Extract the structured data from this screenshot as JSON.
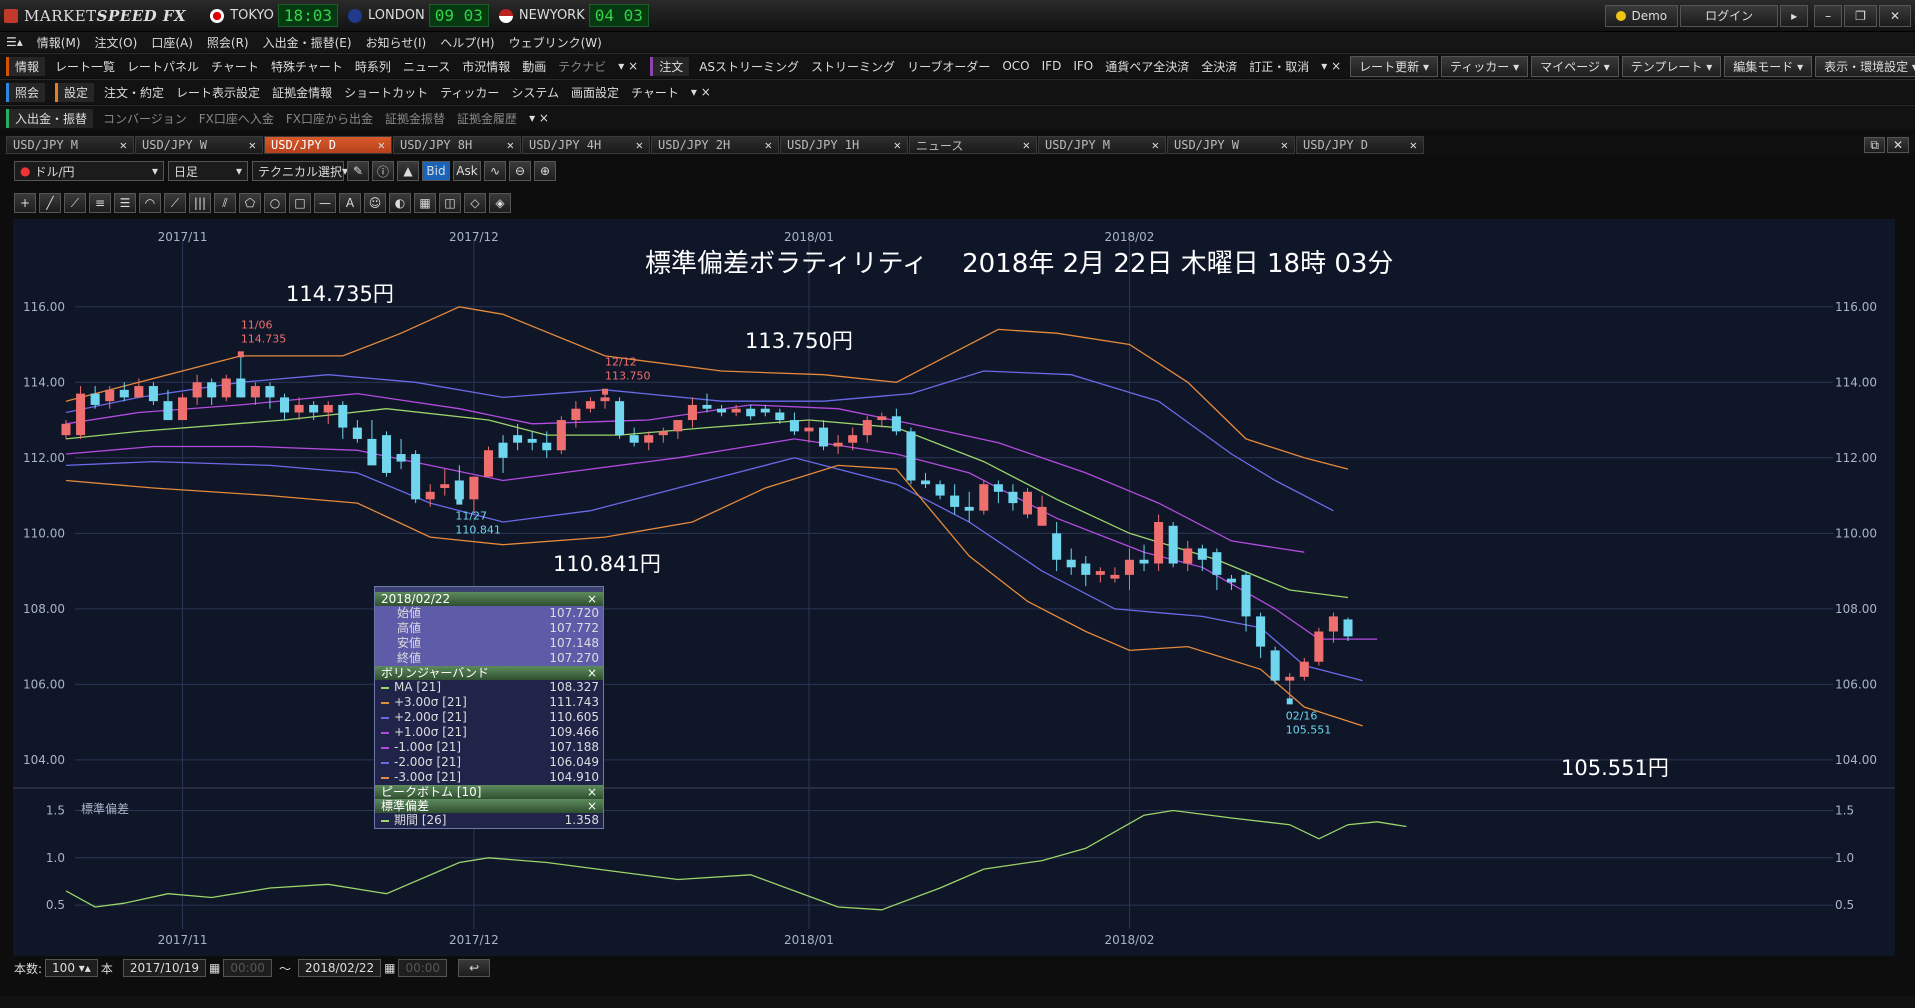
{
  "app": {
    "brand_a": "MARKET",
    "brand_b": "SPEED FX"
  },
  "clocks": [
    {
      "name": "TOKYO",
      "time": "18:03"
    },
    {
      "name": "LONDON",
      "time": "09 03"
    },
    {
      "name": "NEWYORK",
      "time": "04 03"
    }
  ],
  "window_buttons": {
    "demo": "Demo",
    "login": "ログイン"
  },
  "menu": [
    "情報(M)",
    "注文(O)",
    "口座(A)",
    "照会(R)",
    "入出金・振替(E)",
    "お知らせ(I)",
    "ヘルプ(H)",
    "ウェブリンク(W)"
  ],
  "toolbar1": {
    "info_group": "情報",
    "info_items": [
      "レート一覧",
      "レートパネル",
      "チャート",
      "特殊チャート",
      "時系列",
      "ニュース",
      "市況情報",
      "動画"
    ],
    "info_dim": "テクナビ",
    "order_group": "注文",
    "order_items": [
      "ASストリーミング",
      "ストリーミング",
      "リーブオーダー",
      "OCO",
      "IFD",
      "IFO",
      "通貨ペア全決済",
      "全決済",
      "訂正・取消"
    ],
    "right": [
      "レート更新",
      "ティッカー",
      "マイページ",
      "テンプレート",
      "編集モード",
      "表示・環境設定"
    ]
  },
  "toolbar2": {
    "query_group": "照会",
    "settings_group": "設定",
    "settings_items": [
      "注文・約定",
      "レート表示設定",
      "証拠金情報",
      "ショートカット",
      "ティッカー",
      "システム",
      "画面設定",
      "チャート"
    ]
  },
  "toolbar3": {
    "group": "入出金・振替",
    "items": [
      "コンバージョン",
      "FX口座へ入金",
      "FX口座から出金",
      "証拠金振替",
      "証拠金履歴"
    ]
  },
  "tabs": [
    "USD/JPY M",
    "USD/JPY W",
    "USD/JPY D",
    "USD/JPY 8H",
    "USD/JPY 4H",
    "USD/JPY 2H",
    "USD/JPY 1H",
    "ニュース",
    "USD/JPY M",
    "USD/JPY W",
    "USD/JPY D"
  ],
  "active_tab_index": 2,
  "symbol_bar": {
    "pair": "ドル/円",
    "period": "日足",
    "technical": "テクニカル選択",
    "bid": "Bid",
    "ask": "Ask"
  },
  "chart_title": "標準偏差ボラティリティ　 2018年 2月 22日 木曜日 18時 03分",
  "annotations": {
    "high1": "114.735円",
    "high2": "113.750円",
    "low1": "110.841円",
    "low2": "105.551円"
  },
  "marks": {
    "m1_date": "11/06",
    "m1_val": "114.735",
    "m2_date": "12/12",
    "m2_val": "113.750",
    "m3_date": "11/27",
    "m3_val": "110.841",
    "m4_date": "02/16",
    "m4_val": "105.551"
  },
  "info_panel": {
    "date": "2018/02/22",
    "ohlc": [
      {
        "label": "始値",
        "value": "107.720"
      },
      {
        "label": "高値",
        "value": "107.772"
      },
      {
        "label": "安値",
        "value": "107.148"
      },
      {
        "label": "終値",
        "value": "107.270"
      }
    ],
    "bb_title": "ボリンジャーバンド",
    "bb": [
      {
        "label": "MA [21]",
        "value": "108.327",
        "color": "#9bd46a"
      },
      {
        "label": "+3.00σ [21]",
        "value": "111.743",
        "color": "#e58a3c"
      },
      {
        "label": "+2.00σ [21]",
        "value": "110.605",
        "color": "#6a6ae8"
      },
      {
        "label": "+1.00σ [21]",
        "value": "109.466",
        "color": "#b44be0"
      },
      {
        "label": "-1.00σ [21]",
        "value": "107.188",
        "color": "#b44be0"
      },
      {
        "label": "-2.00σ [21]",
        "value": "106.049",
        "color": "#6a6ae8"
      },
      {
        "label": "-3.00σ [21]",
        "value": "104.910",
        "color": "#e58a3c"
      }
    ],
    "pb_title": "ピークボトム [10]",
    "sd_title": "標準偏差",
    "sd_row": {
      "label": "期間 [26]",
      "value": "1.358"
    }
  },
  "bottom_bar": {
    "count_label": "本数:",
    "count": "100",
    "unit": "本",
    "from": "2017/10/19",
    "to": "2018/02/22",
    "time_placeholder": "00:00",
    "tilde": "〜"
  },
  "chart_data": {
    "type": "candlestick",
    "title": "標準偏差ボラティリティ　 2018年 2月 22日 木曜日 18時 03分",
    "x_ticks": [
      "2017/11",
      "2017/12",
      "2018/01",
      "2018/02"
    ],
    "x_tick_bars": [
      8,
      28,
      51,
      73
    ],
    "ylim": [
      103.6,
      117.0
    ],
    "y_ticks": [
      "104.00",
      "106.00",
      "108.00",
      "110.00",
      "112.00",
      "114.00",
      "116.00"
    ],
    "candles": [
      [
        112.6,
        113.0,
        112.5,
        112.9
      ],
      [
        112.6,
        113.9,
        112.5,
        113.7
      ],
      [
        113.7,
        113.9,
        113.3,
        113.4
      ],
      [
        113.5,
        113.9,
        113.3,
        113.8
      ],
      [
        113.8,
        114.0,
        113.5,
        113.6
      ],
      [
        113.6,
        114.1,
        113.6,
        113.9
      ],
      [
        113.9,
        114.0,
        113.4,
        113.5
      ],
      [
        113.5,
        113.8,
        113.0,
        113.0
      ],
      [
        113.0,
        113.7,
        113.0,
        113.6
      ],
      [
        113.6,
        114.2,
        113.4,
        114.0
      ],
      [
        114.0,
        114.1,
        113.4,
        113.6
      ],
      [
        113.6,
        114.2,
        113.5,
        114.1
      ],
      [
        114.1,
        114.74,
        113.6,
        113.6
      ],
      [
        113.6,
        114.0,
        113.4,
        113.9
      ],
      [
        113.9,
        114.0,
        113.3,
        113.6
      ],
      [
        113.6,
        113.7,
        113.0,
        113.2
      ],
      [
        113.2,
        113.6,
        113.0,
        113.4
      ],
      [
        113.4,
        113.5,
        113.0,
        113.2
      ],
      [
        113.2,
        113.5,
        112.9,
        113.4
      ],
      [
        113.4,
        113.5,
        112.5,
        112.8
      ],
      [
        112.8,
        113.0,
        112.4,
        112.5
      ],
      [
        112.5,
        113.0,
        111.8,
        111.8
      ],
      [
        112.6,
        112.7,
        111.5,
        111.6
      ],
      [
        112.1,
        112.5,
        111.7,
        111.9
      ],
      [
        112.1,
        112.2,
        110.8,
        110.9
      ],
      [
        110.9,
        111.3,
        110.7,
        111.1
      ],
      [
        111.2,
        111.7,
        111.0,
        111.3
      ],
      [
        111.4,
        111.8,
        110.84,
        110.9
      ],
      [
        110.9,
        111.5,
        110.5,
        111.5
      ],
      [
        111.5,
        112.3,
        111.5,
        112.2
      ],
      [
        112.4,
        112.6,
        111.6,
        112.0
      ],
      [
        112.6,
        112.9,
        112.2,
        112.4
      ],
      [
        112.5,
        112.7,
        112.2,
        112.4
      ],
      [
        112.4,
        112.7,
        112.0,
        112.2
      ],
      [
        112.2,
        113.1,
        112.1,
        113.0
      ],
      [
        113.0,
        113.5,
        112.8,
        113.3
      ],
      [
        113.3,
        113.6,
        113.2,
        113.5
      ],
      [
        113.5,
        113.75,
        113.3,
        113.6
      ],
      [
        113.5,
        113.6,
        112.5,
        112.6
      ],
      [
        112.6,
        112.8,
        112.3,
        112.4
      ],
      [
        112.4,
        112.7,
        112.2,
        112.6
      ],
      [
        112.6,
        112.8,
        112.4,
        112.7
      ],
      [
        112.7,
        113.0,
        112.5,
        113.0
      ],
      [
        113.0,
        113.6,
        112.8,
        113.4
      ],
      [
        113.4,
        113.7,
        113.2,
        113.3
      ],
      [
        113.3,
        113.4,
        113.1,
        113.2
      ],
      [
        113.2,
        113.4,
        113.1,
        113.3
      ],
      [
        113.3,
        113.4,
        113.0,
        113.1
      ],
      [
        113.3,
        113.4,
        113.1,
        113.2
      ],
      [
        113.2,
        113.3,
        112.9,
        113.0
      ],
      [
        113.0,
        113.2,
        112.6,
        112.7
      ],
      [
        112.7,
        113.0,
        112.4,
        112.8
      ],
      [
        112.8,
        113.0,
        112.2,
        112.3
      ],
      [
        112.3,
        112.6,
        112.1,
        112.4
      ],
      [
        112.4,
        112.8,
        112.2,
        112.6
      ],
      [
        112.6,
        113.1,
        112.4,
        113.0
      ],
      [
        113.0,
        113.2,
        112.8,
        113.1
      ],
      [
        113.1,
        113.3,
        112.6,
        112.7
      ],
      [
        112.7,
        112.8,
        111.3,
        111.4
      ],
      [
        111.4,
        111.6,
        111.2,
        111.3
      ],
      [
        111.3,
        111.4,
        110.9,
        111.0
      ],
      [
        111.0,
        111.3,
        110.5,
        110.7
      ],
      [
        110.7,
        111.1,
        110.3,
        110.6
      ],
      [
        110.6,
        111.4,
        110.5,
        111.3
      ],
      [
        111.3,
        111.4,
        110.8,
        111.1
      ],
      [
        111.1,
        111.3,
        110.6,
        110.8
      ],
      [
        110.5,
        111.2,
        110.4,
        111.1
      ],
      [
        110.2,
        111.0,
        110.2,
        110.7
      ],
      [
        110.0,
        110.3,
        109.0,
        109.3
      ],
      [
        109.3,
        109.6,
        108.9,
        109.1
      ],
      [
        109.2,
        109.4,
        108.6,
        108.9
      ],
      [
        108.9,
        109.1,
        108.7,
        109.0
      ],
      [
        108.8,
        109.1,
        108.7,
        108.9
      ],
      [
        108.9,
        109.6,
        108.5,
        109.3
      ],
      [
        109.3,
        109.7,
        109.0,
        109.2
      ],
      [
        109.2,
        110.5,
        109.0,
        110.3
      ],
      [
        110.2,
        110.3,
        109.1,
        109.2
      ],
      [
        109.2,
        109.8,
        109.0,
        109.6
      ],
      [
        109.6,
        109.7,
        109.0,
        109.3
      ],
      [
        109.5,
        109.6,
        108.5,
        108.9
      ],
      [
        108.8,
        108.9,
        108.5,
        108.7
      ],
      [
        108.9,
        109.0,
        107.4,
        107.8
      ],
      [
        107.8,
        107.9,
        106.7,
        107.0
      ],
      [
        106.9,
        107.0,
        106.0,
        106.1
      ],
      [
        106.1,
        106.3,
        105.55,
        106.2
      ],
      [
        106.2,
        106.7,
        106.1,
        106.6
      ],
      [
        106.6,
        107.5,
        106.5,
        107.4
      ],
      [
        107.4,
        107.9,
        107.1,
        107.8
      ],
      [
        107.72,
        107.77,
        107.15,
        107.27
      ]
    ],
    "bands": {
      "ma": [
        [
          0,
          112.5
        ],
        [
          5,
          112.7
        ],
        [
          15,
          113.0
        ],
        [
          22,
          113.3
        ],
        [
          29,
          113.0
        ],
        [
          33,
          112.6
        ],
        [
          38,
          112.6
        ],
        [
          44,
          112.8
        ],
        [
          51,
          113.0
        ],
        [
          57,
          112.8
        ],
        [
          63,
          111.9
        ],
        [
          68,
          110.9
        ],
        [
          73,
          110.0
        ],
        [
          79,
          109.3
        ],
        [
          84,
          108.5
        ],
        [
          88,
          108.3
        ]
      ],
      "p1": [
        [
          0,
          112.9
        ],
        [
          5,
          113.2
        ],
        [
          12,
          113.4
        ],
        [
          20,
          113.7
        ],
        [
          27,
          113.3
        ],
        [
          32,
          112.9
        ],
        [
          40,
          113.0
        ],
        [
          47,
          113.4
        ],
        [
          53,
          113.3
        ],
        [
          58,
          112.9
        ],
        [
          64,
          112.4
        ],
        [
          70,
          111.6
        ],
        [
          75,
          110.8
        ],
        [
          80,
          109.8
        ],
        [
          85,
          109.5
        ]
      ],
      "p2": [
        [
          0,
          113.2
        ],
        [
          5,
          113.6
        ],
        [
          12,
          114.0
        ],
        [
          18,
          114.2
        ],
        [
          24,
          114.0
        ],
        [
          30,
          113.6
        ],
        [
          37,
          113.8
        ],
        [
          45,
          113.5
        ],
        [
          52,
          113.5
        ],
        [
          58,
          113.7
        ],
        [
          63,
          114.3
        ],
        [
          69,
          114.2
        ],
        [
          75,
          113.5
        ],
        [
          80,
          112.1
        ],
        [
          83,
          111.4
        ],
        [
          87,
          110.6
        ]
      ],
      "p3": [
        [
          0,
          113.5
        ],
        [
          5,
          114.0
        ],
        [
          12,
          114.7
        ],
        [
          19,
          114.7
        ],
        [
          23,
          115.3
        ],
        [
          27,
          116.0
        ],
        [
          30,
          115.8
        ],
        [
          37,
          114.7
        ],
        [
          45,
          114.3
        ],
        [
          52,
          114.2
        ],
        [
          57,
          114.0
        ],
        [
          61,
          114.8
        ],
        [
          64,
          115.4
        ],
        [
          68,
          115.3
        ],
        [
          73,
          115.0
        ],
        [
          77,
          114.0
        ],
        [
          81,
          112.5
        ],
        [
          85,
          112.0
        ],
        [
          88,
          111.7
        ]
      ],
      "m1": [
        [
          0,
          112.1
        ],
        [
          6,
          112.3
        ],
        [
          13,
          112.3
        ],
        [
          20,
          112.2
        ],
        [
          25,
          111.8
        ],
        [
          30,
          111.4
        ],
        [
          36,
          111.7
        ],
        [
          42,
          112.0
        ],
        [
          50,
          112.5
        ],
        [
          57,
          112.1
        ],
        [
          62,
          111.6
        ],
        [
          68,
          110.4
        ],
        [
          74,
          109.5
        ],
        [
          78,
          109.1
        ],
        [
          83,
          108.0
        ],
        [
          86,
          107.2
        ],
        [
          90,
          107.2
        ]
      ],
      "m2": [
        [
          0,
          111.8
        ],
        [
          6,
          111.9
        ],
        [
          14,
          111.8
        ],
        [
          20,
          111.6
        ],
        [
          25,
          110.8
        ],
        [
          30,
          110.3
        ],
        [
          36,
          110.6
        ],
        [
          42,
          111.2
        ],
        [
          50,
          112.0
        ],
        [
          57,
          111.3
        ],
        [
          62,
          110.3
        ],
        [
          67,
          109.0
        ],
        [
          72,
          108.0
        ],
        [
          78,
          107.8
        ],
        [
          82,
          107.5
        ],
        [
          85,
          106.5
        ],
        [
          89,
          106.1
        ]
      ],
      "m3": [
        [
          0,
          111.4
        ],
        [
          6,
          111.2
        ],
        [
          14,
          111.0
        ],
        [
          20,
          110.8
        ],
        [
          25,
          109.9
        ],
        [
          30,
          109.7
        ],
        [
          37,
          109.9
        ],
        [
          43,
          110.3
        ],
        [
          48,
          111.2
        ],
        [
          53,
          111.8
        ],
        [
          57,
          111.7
        ],
        [
          62,
          109.4
        ],
        [
          66,
          108.2
        ],
        [
          70,
          107.4
        ],
        [
          73,
          106.9
        ],
        [
          77,
          107.0
        ],
        [
          82,
          106.4
        ],
        [
          85,
          105.4
        ],
        [
          89,
          104.9
        ]
      ]
    },
    "band_colors": {
      "ma": "#9bd46a",
      "p1": "#b44be0",
      "p2": "#6a6ae8",
      "p3": "#e58a3c",
      "m1": "#b44be0",
      "m2": "#6a6ae8",
      "m3": "#e58a3c"
    },
    "subchart": {
      "label": "標準偏差",
      "ylim": [
        0.3,
        1.6
      ],
      "y_ticks": [
        "0.5",
        "1.0",
        "1.5"
      ],
      "values": [
        [
          0,
          0.65
        ],
        [
          2,
          0.48
        ],
        [
          4,
          0.52
        ],
        [
          7,
          0.62
        ],
        [
          10,
          0.58
        ],
        [
          14,
          0.68
        ],
        [
          18,
          0.72
        ],
        [
          22,
          0.62
        ],
        [
          27,
          0.95
        ],
        [
          29,
          1.0
        ],
        [
          33,
          0.95
        ],
        [
          38,
          0.85
        ],
        [
          42,
          0.77
        ],
        [
          47,
          0.82
        ],
        [
          50,
          0.65
        ],
        [
          53,
          0.48
        ],
        [
          56,
          0.45
        ],
        [
          60,
          0.68
        ],
        [
          63,
          0.88
        ],
        [
          67,
          0.97
        ],
        [
          70,
          1.1
        ],
        [
          74,
          1.45
        ],
        [
          76,
          1.5
        ],
        [
          80,
          1.42
        ],
        [
          84,
          1.35
        ],
        [
          86,
          1.2
        ],
        [
          88,
          1.35
        ],
        [
          90,
          1.38
        ],
        [
          92,
          1.33
        ]
      ]
    },
    "colors": {
      "up": "#ef6f6f",
      "down": "#6fd6ee",
      "grid": "#2b3555",
      "axis_text": "#aab3c8"
    }
  }
}
